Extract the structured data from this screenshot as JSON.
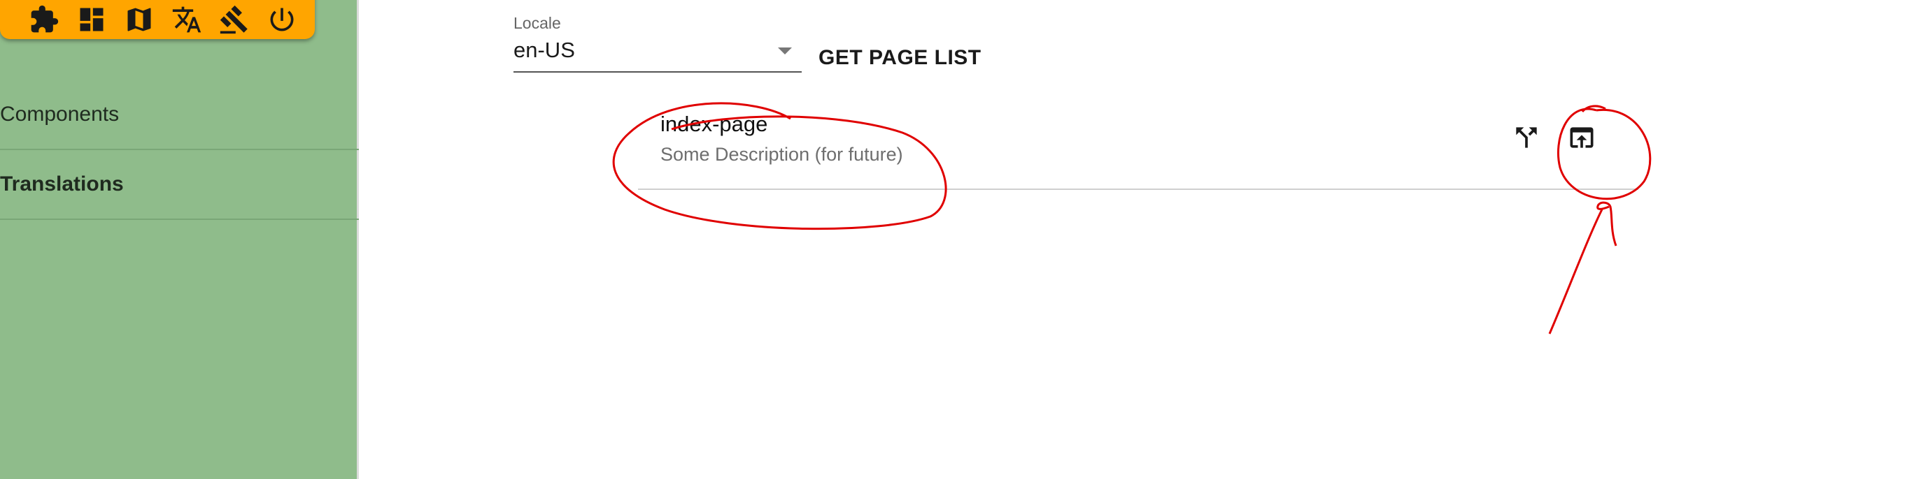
{
  "toolbar": {
    "icons": [
      "puzzle-icon",
      "dashboard-icon",
      "map-icon",
      "translate-icon",
      "gavel-icon",
      "power-icon"
    ],
    "accent_color": "#ffa500"
  },
  "sidebar": {
    "background": "#8fbc8b",
    "items": [
      {
        "label": "Components",
        "active": false
      },
      {
        "label": "Translations",
        "active": true
      }
    ]
  },
  "locale": {
    "label": "Locale",
    "value": "en-US"
  },
  "actions": {
    "get_page_list": "GET PAGE LIST"
  },
  "pages": [
    {
      "title": "index-page",
      "description": "Some Description (for future)",
      "icons": [
        "fork-icon",
        "open-in-browser-icon"
      ]
    }
  ],
  "annotation_color": "#e00000"
}
